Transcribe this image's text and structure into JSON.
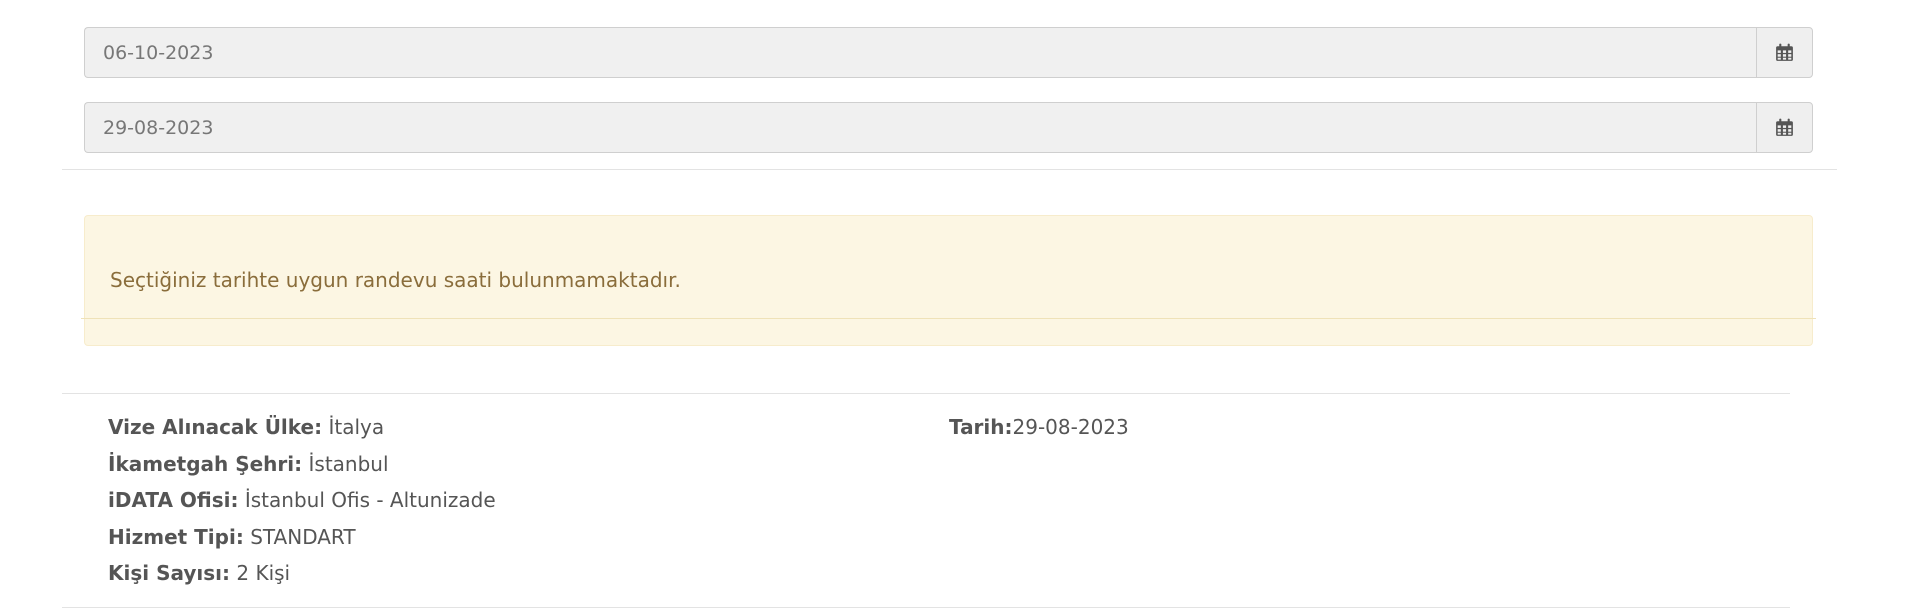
{
  "date_fields": [
    {
      "value": "06-10-2023",
      "icon": "calendar-icon"
    },
    {
      "value": "29-08-2023",
      "icon": "calendar-icon"
    }
  ],
  "alert": {
    "message": "Seçtiğiniz tarihte uygun randevu saati bulunmamaktadır."
  },
  "summary": {
    "country_label": "Vize Alınacak Ülke:",
    "country_value": " İtalya",
    "city_label": "İkametgah Şehri:",
    "city_value": " İstanbul",
    "office_label": "iDATA Ofisi:",
    "office_value": " İstanbul Ofis - Altunizade",
    "service_label": "Hizmet Tipi:",
    "service_value": " STANDART",
    "persons_label": "Kişi Sayısı:",
    "persons_value": " 2 Kişi",
    "date_label": "Tarih:",
    "date_value": "29-08-2023"
  },
  "colors": {
    "input_bg": "#f0f0f0",
    "alert_bg": "#fcf6e3",
    "alert_text": "#8a6d3b",
    "icon": "#555555"
  }
}
